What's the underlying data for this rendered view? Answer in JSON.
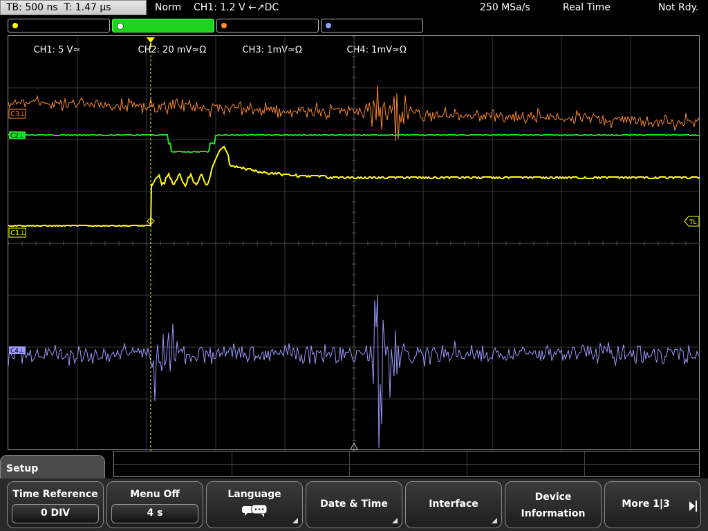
{
  "status": {
    "timebase": "TB: 500 ns  T: 1.47 µs",
    "trigger_mode": "Norm",
    "trigger_info": "CH1: 1.2 V ←↗DC",
    "sample_rate": "250 MSa/s",
    "acq_mode": "Real Time",
    "state": "Not Rdy."
  },
  "channels": [
    {
      "label": "CH1: 5 V≃",
      "color": "#ffff00",
      "active": false
    },
    {
      "label": "CH2: 20 mV≃Ω",
      "color": "#22dd22",
      "active": true
    },
    {
      "label": "CH3: 1mV≃Ω",
      "color": "#ff8a2a",
      "active": false
    },
    {
      "label": "CH4: 1mV≃Ω",
      "color": "#9a9aff",
      "active": false
    }
  ],
  "markers": {
    "c3": "C3⊥",
    "c2": "C2⊥",
    "c1": "C1⊥",
    "c4": "C4⊥",
    "trigger_level": "TL",
    "trigger_pos": "T"
  },
  "menu": {
    "title": "Setup",
    "softkeys": [
      {
        "label": "Time Reference",
        "value": "0 DIV"
      },
      {
        "label": "Menu Off",
        "value": "4 s"
      },
      {
        "label": "Language",
        "icon": "speech-bubble-icon"
      },
      {
        "label": "Date & Time"
      },
      {
        "label": "Interface"
      },
      {
        "label": "Device",
        "label2": "Information"
      },
      {
        "label": "More 1|3"
      }
    ]
  }
}
